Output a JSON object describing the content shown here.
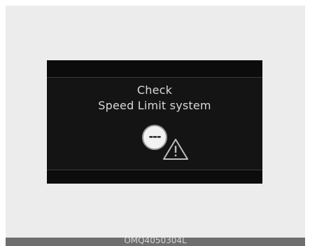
{
  "message": {
    "line1": "Check",
    "line2": "Speed Limit system"
  },
  "speed_limit_icon": {
    "text": "---",
    "icon": "speed-limit-sign-icon"
  },
  "warning_icon": "warning-triangle-icon",
  "caption": "OMQ4050304L"
}
